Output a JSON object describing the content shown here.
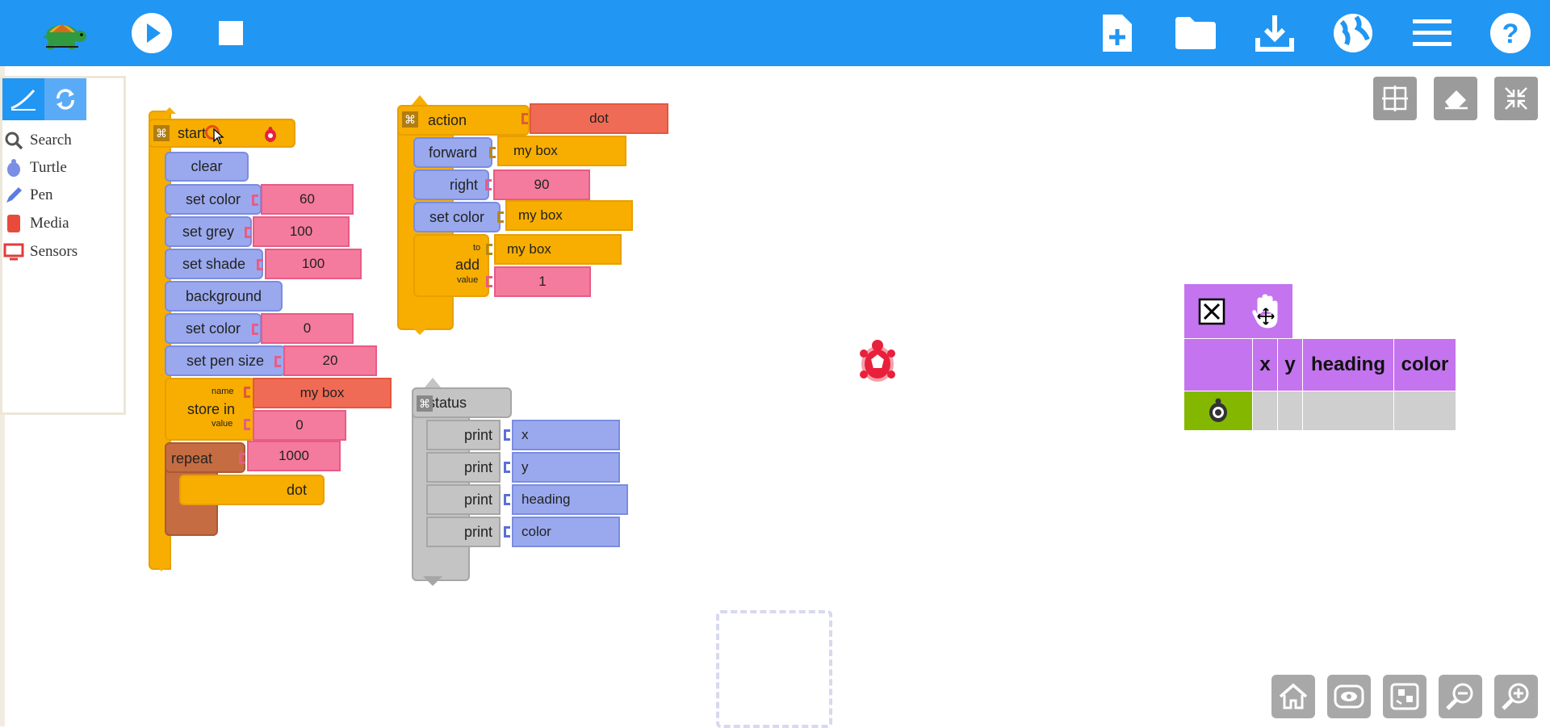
{
  "topbar": {
    "icons": [
      "turtle-logo",
      "play-icon",
      "stop-icon",
      "new-file-icon",
      "open-folder-icon",
      "save-download-icon",
      "language-globe-icon",
      "menu-icon",
      "help-icon"
    ]
  },
  "palette": {
    "tabs": [
      "pen-tab",
      "refresh-tab"
    ],
    "items": [
      "Search",
      "Turtle",
      "Pen",
      "Media",
      "Sensors"
    ]
  },
  "start_stack": {
    "hat": "start",
    "blocks": [
      {
        "label": "clear"
      },
      {
        "label": "set color",
        "arg": "60"
      },
      {
        "label": "set grey",
        "arg": "100"
      },
      {
        "label": "set shade",
        "arg": "100"
      },
      {
        "label": "background"
      },
      {
        "label": "set color",
        "arg": "0"
      },
      {
        "label": "set pen size",
        "arg": "20"
      }
    ],
    "store": {
      "label": "store in",
      "name_label": "name",
      "value_label": "value",
      "name": "my box",
      "value": "0"
    },
    "repeat": {
      "label": "repeat",
      "arg": "1000",
      "inner": "dot"
    }
  },
  "action_stack": {
    "hat": "action",
    "name": "dot",
    "blocks": [
      {
        "label": "forward",
        "arg": "my box"
      },
      {
        "label": "right",
        "arg": "90"
      },
      {
        "label": "set color",
        "arg": "my box"
      }
    ],
    "add": {
      "label": "add",
      "to_label": "to",
      "value_label": "value",
      "to": "my box",
      "value": "1"
    }
  },
  "status_stack": {
    "hat": "status",
    "blocks": [
      {
        "label": "print",
        "arg": "x"
      },
      {
        "label": "print",
        "arg": "y"
      },
      {
        "label": "print",
        "arg": "heading"
      },
      {
        "label": "print",
        "arg": "color"
      }
    ]
  },
  "status_table": {
    "headers": [
      "x",
      "y",
      "heading",
      "color"
    ],
    "row": [
      "",
      "",
      "",
      ""
    ]
  },
  "colors": {
    "topbar": "#2196f3",
    "palette_accent": "#5aabf7",
    "blue_block": "#9aa9ee",
    "orange_block": "#f7ae00",
    "pink_arg": "#f47b9d",
    "red_block": "#f06b55",
    "grey_block": "#c4c4c4",
    "status_purple": "#c474ee",
    "status_green": "#84b800",
    "turtle_red": "#e8203c"
  }
}
